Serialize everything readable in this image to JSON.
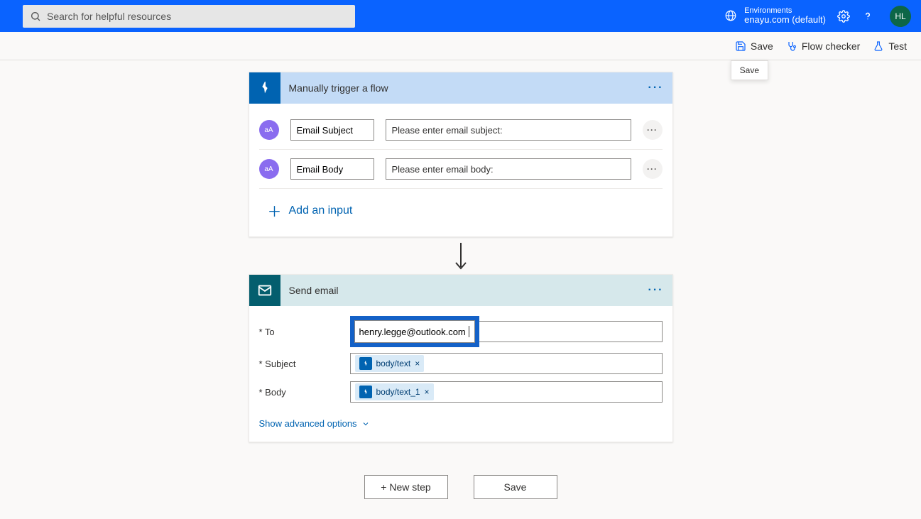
{
  "header": {
    "search_placeholder": "Search for helpful resources",
    "env_label": "Environments",
    "env_name": "enayu.com (default)",
    "avatar_initials": "HL"
  },
  "toolbar": {
    "save": "Save",
    "flow_checker": "Flow checker",
    "test": "Test",
    "tooltip": "Save"
  },
  "trigger_card": {
    "title": "Manually trigger a flow",
    "params": [
      {
        "type_badge": "aA",
        "name": "Email Subject",
        "prompt": "Please enter email subject:"
      },
      {
        "type_badge": "aA",
        "name": "Email Body",
        "prompt": "Please enter email body:"
      }
    ],
    "add_input_label": "Add an input"
  },
  "action_card": {
    "title": "Send email",
    "fields": {
      "to_label": "* To",
      "to_value": "henry.legge@outlook.com",
      "subject_label": "* Subject",
      "subject_token": "body/text",
      "body_label": "* Body",
      "body_token": "body/text_1"
    },
    "advanced_label": "Show advanced options"
  },
  "bottom": {
    "new_step": "+ New step",
    "save": "Save"
  }
}
